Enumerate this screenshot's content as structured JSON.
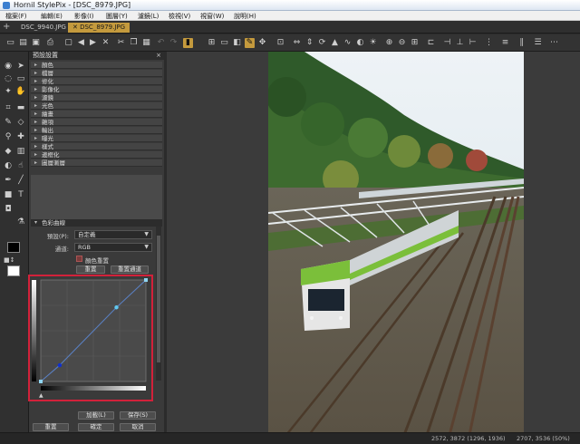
{
  "window": {
    "title": "Hornil StylePix - [DSC_8979.JPG]"
  },
  "menu": [
    "檔案(F)",
    "編輯(E)",
    "影像(I)",
    "圖層(Y)",
    "濾鏡(L)",
    "檢視(V)",
    "視窗(W)",
    "說明(H)"
  ],
  "tabs": [
    {
      "label": "DSC_9940.JPG",
      "active": false
    },
    {
      "label": "DSC_8979.JPG",
      "active": true
    }
  ],
  "panel": {
    "title": "預設設置",
    "close": "×",
    "sections": [
      "顏色",
      "檔層",
      "修化",
      "影像化",
      "濾鏡",
      "光色",
      "繪畫",
      "雜項",
      "輸出",
      "曝光",
      "樣式",
      "邊框化",
      "圖層漸層"
    ],
    "curve": {
      "title": "色彩曲線",
      "preset_label": "預設(P):",
      "preset_value": "自定義",
      "channel_label": "通道:",
      "channel_value": "RGB",
      "checkbox_label": "顏色重置",
      "btn_reset": "重置",
      "btn_reset_all": "重置通道",
      "points": [
        [
          0,
          0
        ],
        [
          0.18,
          0.16
        ],
        [
          0.72,
          0.73
        ],
        [
          1,
          1
        ]
      ]
    },
    "footer": {
      "btn_add": "加載(L)",
      "btn_save": "保存(S)",
      "btn_reset": "重置",
      "btn_ok": "確定",
      "btn_cancel": "取消"
    }
  },
  "status": {
    "coords1": "2572, 3872 (1296, 1936)",
    "coords2": "2707, 3536 (50%)"
  },
  "colors": {
    "accent": "#c49a3d",
    "highlight_box": "#d2213a",
    "curve_line": "#5a7fc0"
  }
}
